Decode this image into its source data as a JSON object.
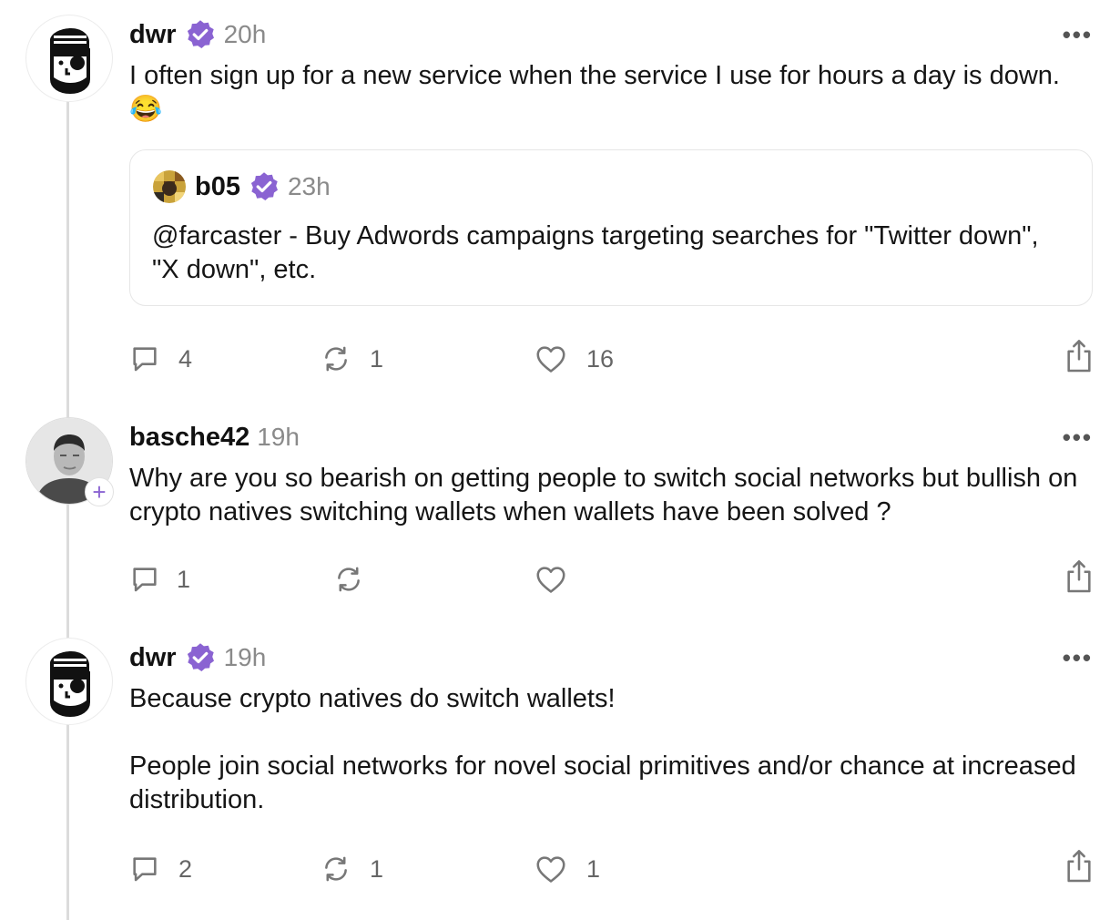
{
  "casts": [
    {
      "username": "dwr",
      "verified": true,
      "time": "20h",
      "text": "I often sign up for a new service when the service I use for hours a day is down. 😂",
      "quote": {
        "username": "b05",
        "verified": true,
        "time": "23h",
        "text": "@farcaster - Buy Adwords campaigns targeting searches for \"Twitter down\", \"X down\", etc."
      },
      "actions": {
        "replies": "4",
        "recasts": "1",
        "likes": "16"
      }
    },
    {
      "username": "basche42",
      "verified": false,
      "time": "19h",
      "text": "Why are you so bearish on getting people to switch social networks but bullish on crypto natives switching wallets when wallets have been solved ?",
      "follow_symbol": "+",
      "actions": {
        "replies": "1",
        "recasts": "",
        "likes": ""
      }
    },
    {
      "username": "dwr",
      "verified": true,
      "time": "19h",
      "text": "Because crypto natives do switch wallets!\n\nPeople join social networks for novel social primitives and/or chance at increased distribution.",
      "actions": {
        "replies": "2",
        "recasts": "1",
        "likes": "1"
      }
    }
  ],
  "more_symbol": "•••",
  "icons": {
    "verified": "verified-badge-icon",
    "reply": "comment-icon",
    "recast": "recast-icon",
    "like": "heart-icon",
    "share": "share-icon",
    "more": "more-horizontal-icon"
  },
  "colors": {
    "verified": "#8a63d2",
    "thread_line": "#dcdcdc",
    "muted": "#8a8a8a"
  }
}
